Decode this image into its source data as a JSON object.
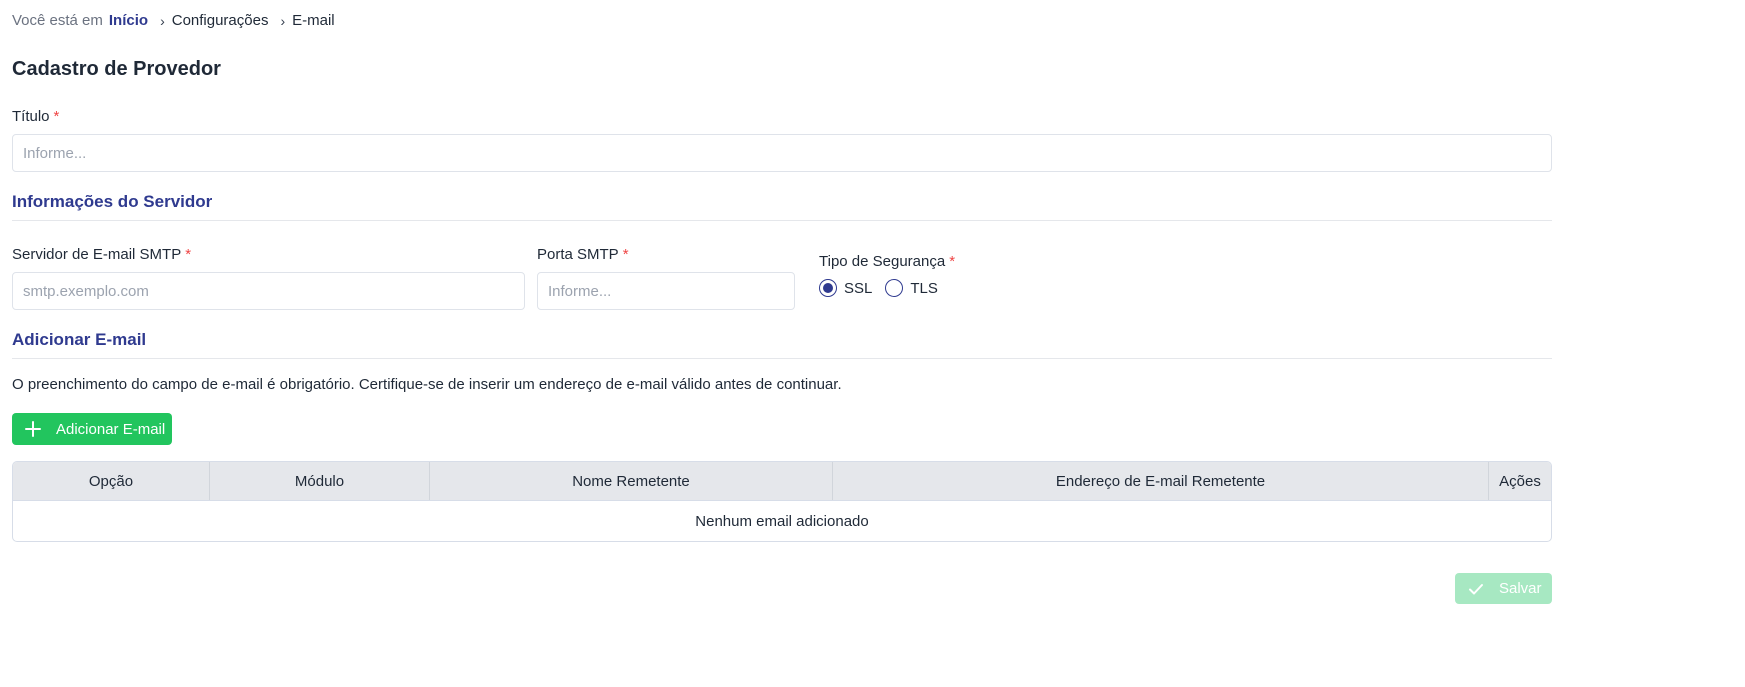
{
  "breadcrumb": {
    "prefix": "Você está em",
    "home": "Início",
    "items": [
      "Configurações",
      "E-mail"
    ]
  },
  "page_title": "Cadastro de Provedor",
  "form": {
    "titulo": {
      "label": "Título",
      "required": "*",
      "placeholder": "Informe..."
    },
    "server_section_title": "Informações do Servidor",
    "smtp_server": {
      "label": "Servidor de E-mail SMTP",
      "required": "*",
      "placeholder": "smtp.exemplo.com"
    },
    "smtp_port": {
      "label": "Porta SMTP",
      "required": "*",
      "placeholder": "Informe..."
    },
    "security": {
      "label": "Tipo de Segurança",
      "required": "*",
      "options": [
        {
          "label": "SSL",
          "selected": true
        },
        {
          "label": "TLS",
          "selected": false
        }
      ]
    }
  },
  "email_section": {
    "title": "Adicionar E-mail",
    "description": "O preenchimento do campo de e-mail é obrigatório. Certifique-se de inserir um endereço de e-mail válido antes de continuar.",
    "add_button": "Adicionar E-mail",
    "table": {
      "columns": [
        "Opção",
        "Módulo",
        "Nome Remetente",
        "Endereço de E-mail Remetente",
        "Ações"
      ],
      "empty_message": "Nenhum email adicionado"
    }
  },
  "save_button": "Salvar",
  "colors": {
    "accent": "#2f3a8f",
    "required": "#ef4444",
    "add_button": "#22c55e",
    "save_button_disabled": "#a7e8c2"
  },
  "icons": {
    "add_button": "plus-icon",
    "save_button": "check-icon",
    "breadcrumb_separator": "chevron-right-icon"
  }
}
